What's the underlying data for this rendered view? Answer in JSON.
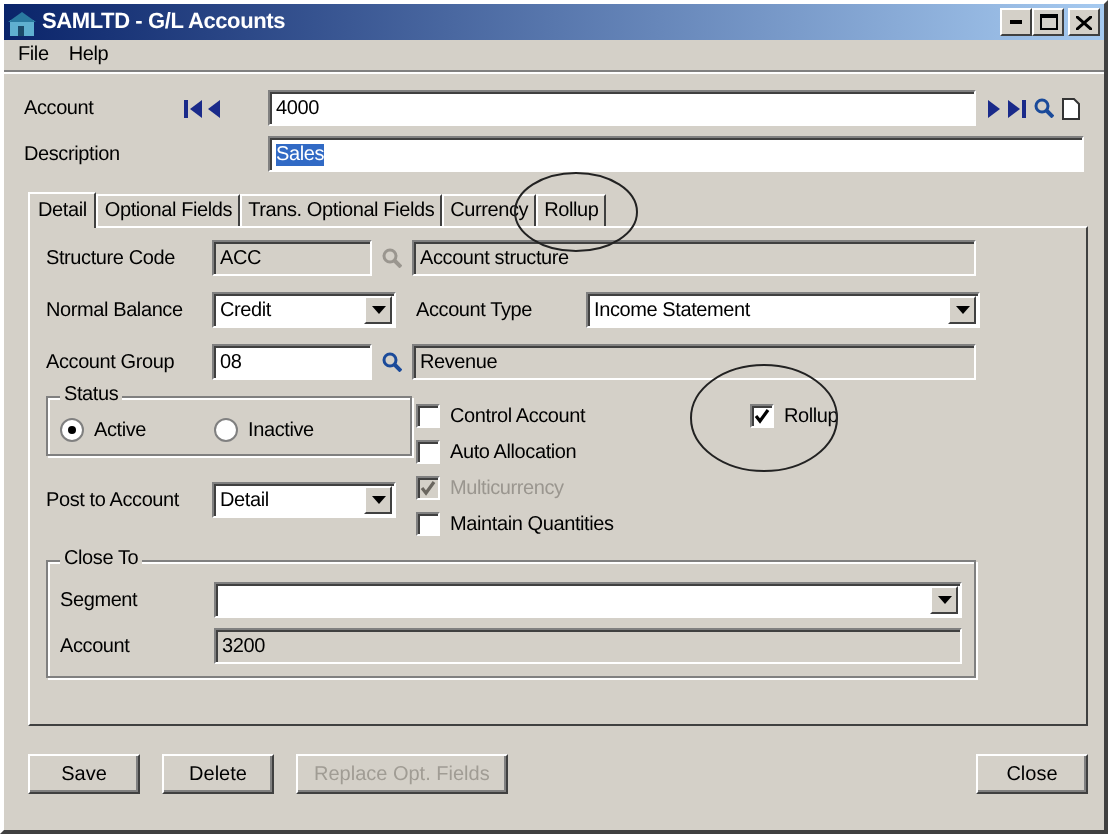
{
  "window": {
    "title": "SAMLTD - G/L Accounts"
  },
  "menu": [
    {
      "label": "File"
    },
    {
      "label": "Help"
    }
  ],
  "account": {
    "label": "Account",
    "value": "4000"
  },
  "description": {
    "label": "Description",
    "value": "Sales",
    "selected": true
  },
  "tabs": [
    {
      "label": "Detail",
      "selected": true
    },
    {
      "label": "Optional Fields",
      "selected": false
    },
    {
      "label": "Trans. Optional Fields",
      "selected": false
    },
    {
      "label": "Currency",
      "selected": false
    },
    {
      "label": "Rollup",
      "selected": false,
      "circled": true
    }
  ],
  "detail": {
    "structure_code": {
      "label": "Structure Code",
      "value": "ACC",
      "description": "Account structure"
    },
    "normal_balance": {
      "label": "Normal Balance",
      "value": "Credit"
    },
    "account_type": {
      "label": "Account Type",
      "value": "Income Statement"
    },
    "account_group": {
      "label": "Account Group",
      "value": "08",
      "description": "Revenue"
    },
    "status": {
      "label": "Status",
      "options": [
        {
          "label": "Active",
          "selected": true
        },
        {
          "label": "Inactive",
          "selected": false
        }
      ]
    },
    "post_to_account": {
      "label": "Post to Account",
      "value": "Detail"
    },
    "checkboxes": [
      {
        "label": "Control Account",
        "checked": false,
        "disabled": false
      },
      {
        "label": "Auto Allocation",
        "checked": false,
        "disabled": false
      },
      {
        "label": "Multicurrency",
        "checked": true,
        "disabled": true
      },
      {
        "label": "Maintain Quantities",
        "checked": false,
        "disabled": false
      }
    ],
    "rollup": {
      "label": "Rollup",
      "checked": true,
      "disabled": false,
      "circled": true
    },
    "close_to": {
      "label": "Close To",
      "segment_label": "Segment",
      "account_label": "Account",
      "account_value": "3200"
    }
  },
  "buttons": [
    {
      "label": "Save",
      "disabled": false
    },
    {
      "label": "Delete",
      "disabled": false
    },
    {
      "label": "Replace Opt. Fields",
      "disabled": true
    }
  ],
  "close_button": {
    "label": "Close",
    "disabled": false
  }
}
